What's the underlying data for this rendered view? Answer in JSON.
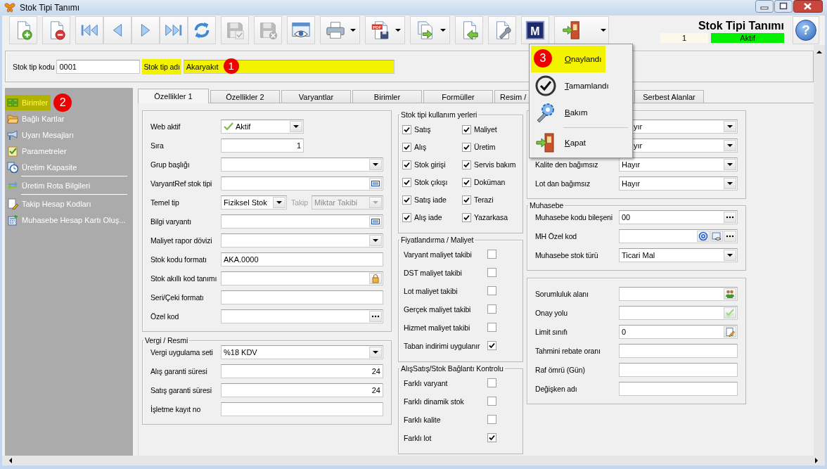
{
  "window": {
    "title": "Stok Tipi Tanımı"
  },
  "toolbar": [
    {
      "kind": "new",
      "disabled": false,
      "dropdown": false
    },
    {
      "kind": "delete",
      "disabled": false,
      "dropdown": false
    },
    {
      "kind": "first",
      "disabled": false,
      "dropdown": false
    },
    {
      "kind": "prev",
      "disabled": false,
      "dropdown": false
    },
    {
      "kind": "next",
      "disabled": false,
      "dropdown": false
    },
    {
      "kind": "last",
      "disabled": false,
      "dropdown": false
    },
    {
      "kind": "refresh",
      "disabled": false,
      "dropdown": false
    },
    {
      "kind": "save",
      "disabled": true,
      "dropdown": false
    },
    {
      "kind": "discard",
      "disabled": true,
      "dropdown": false
    },
    {
      "kind": "preview",
      "disabled": false,
      "dropdown": false
    },
    {
      "kind": "print",
      "disabled": false,
      "dropdown": true
    },
    {
      "kind": "pdf",
      "disabled": false,
      "dropdown": true,
      "label": "PDF"
    },
    {
      "kind": "copy",
      "disabled": false,
      "dropdown": true
    },
    {
      "kind": "import",
      "disabled": false,
      "dropdown": false
    },
    {
      "kind": "tools",
      "disabled": false,
      "dropdown": false
    },
    {
      "kind": "m",
      "disabled": false,
      "dropdown": false,
      "label": "M"
    },
    {
      "kind": "exit",
      "disabled": false,
      "dropdown": true
    }
  ],
  "header": {
    "title": "Stok Tipi Tanımı",
    "number": "1",
    "status": "Aktif",
    "help": "?"
  },
  "record": {
    "code_label": "Stok tip kodu",
    "code": "0001",
    "name_label": "Stok tip adı",
    "name": "Akaryakıt",
    "highlighted": true,
    "callout": "1"
  },
  "sidebar": {
    "items": [
      {
        "kind": "units",
        "label": "Birimler",
        "highlighted": true,
        "callout": "2"
      },
      {
        "kind": "folder",
        "label": "Bağlı Kartlar",
        "highlighted": false
      },
      {
        "kind": "alert",
        "label": "Uyarı Mesajları",
        "highlighted": false
      },
      {
        "kind": "params",
        "label": "Parametreler",
        "highlighted": false
      },
      {
        "kind": "capacity",
        "label": "Üretim Kapasite",
        "highlighted": false
      },
      {
        "kind": "separator"
      },
      {
        "kind": "route",
        "label": "Üretim Rota Bilgileri",
        "highlighted": false
      },
      {
        "kind": "separator"
      },
      {
        "kind": "tracking",
        "label": "Takip Hesap Kodları",
        "highlighted": false
      },
      {
        "kind": "accounting",
        "label": "Muhasebe Hesap Kartı Oluş...",
        "highlighted": false
      }
    ]
  },
  "tabs": [
    {
      "label": "Özellikler 1",
      "selected": true
    },
    {
      "label": "Özellikler 2",
      "selected": false
    },
    {
      "label": "Varyantlar",
      "selected": false
    },
    {
      "label": "Birimler",
      "selected": false
    },
    {
      "label": "Formüller",
      "selected": false
    },
    {
      "label": "Resim /",
      "selected": false
    },
    {
      "label": "Serbest Alanlar",
      "selected": false
    }
  ],
  "tab_page": {
    "columns": [
      {
        "sections": [
          {
            "kind": "fields",
            "rows": [
              {
                "kind": "status",
                "label": "Web aktif",
                "value": "Aktif",
                "buttons": [
                  {
                    "kind": "dropdown"
                  }
                ]
              },
              {
                "kind": "short",
                "label": "Sıra",
                "value": "1",
                "numeric": true
              },
              {
                "kind": "field",
                "label": "Grup başlığı",
                "buttons": [
                  {
                    "kind": "dropdown"
                  }
                ]
              },
              {
                "kind": "field",
                "label": "VaryantRef stok tipi",
                "buttons": [
                  {
                    "kind": "barcode"
                  }
                ]
              },
              {
                "kind": "pair",
                "label": "Temel tip",
                "value": "Fiziksel Stok",
                "buttons": [
                  {
                    "kind": "dropdown"
                  }
                ],
                "second_label": "Takip",
                "second_value": "Miktar Takibi",
                "second_disabled": true
              },
              {
                "kind": "field",
                "label": "Bilgi varyantı",
                "buttons": [
                  {
                    "kind": "barcode"
                  }
                ]
              },
              {
                "kind": "field",
                "label": "Maliyet rapor dövizi",
                "buttons": [
                  {
                    "kind": "dropdown"
                  }
                ]
              },
              {
                "kind": "field",
                "label": "Stok kodu formatı",
                "value": "AKA.0000"
              },
              {
                "kind": "field",
                "label": "Stok akıllı kod tanımı",
                "buttons": [
                  {
                    "kind": "lock"
                  }
                ]
              },
              {
                "kind": "field",
                "label": "Seri/Çeki formatı"
              },
              {
                "kind": "field",
                "label": "Özel kod",
                "buttons": [
                  {
                    "kind": "ellipsis"
                  }
                ]
              }
            ]
          },
          {
            "kind": "fields",
            "title": "Vergi / Resmi",
            "rows": [
              {
                "kind": "field",
                "label": "Vergi uygulama seti",
                "value": "%18 KDV",
                "buttons": [
                  {
                    "kind": "dropdown"
                  }
                ]
              },
              {
                "kind": "field",
                "label": "Alış garanti süresi",
                "value": "24",
                "numeric": true
              },
              {
                "kind": "field",
                "label": "Satış garanti süresi",
                "value": "24",
                "numeric": true
              },
              {
                "kind": "field",
                "label": "İşletme kayıt no"
              }
            ]
          }
        ]
      },
      {
        "sections": [
          {
            "kind": "check_grid",
            "title": "Stok tipi kullanım yerleri",
            "items": [
              {
                "label": "Satış",
                "checked": true
              },
              {
                "label": "Maliyet",
                "checked": true
              },
              {
                "label": "Alış",
                "checked": true
              },
              {
                "label": "Üretim",
                "checked": true
              },
              {
                "label": "Stok girişi",
                "checked": true
              },
              {
                "label": "Servis bakım",
                "checked": true
              },
              {
                "label": "Stok çıkışı",
                "checked": true
              },
              {
                "label": "Doküman",
                "checked": true
              },
              {
                "label": "Satış iade",
                "checked": true
              },
              {
                "label": "Terazi",
                "checked": true
              },
              {
                "label": "Alış iade",
                "checked": true
              },
              {
                "label": "Yazarkasa",
                "checked": true
              }
            ]
          },
          {
            "kind": "check_list",
            "title": "Fiyatlandırma / Maliyet",
            "items": [
              {
                "label": "Varyant maliyet takibi",
                "checked": false
              },
              {
                "label": "DST maliyet takibi",
                "checked": false
              },
              {
                "label": "Lot maliyet takibi",
                "checked": false
              },
              {
                "label": "Gerçek maliyet takibi",
                "checked": false
              },
              {
                "label": "Hizmet maliyet takibi",
                "checked": false
              },
              {
                "label": "Taban indirimi uygulanır",
                "checked": true
              }
            ]
          },
          {
            "kind": "check_list",
            "title": "AlışSatış/Stok Bağlantı Kontrolu",
            "items": [
              {
                "label": "Farklı varyant",
                "checked": false
              },
              {
                "label": "Farklı dinamik stok",
                "checked": false
              },
              {
                "label": "Farklı kalite",
                "checked": false
              },
              {
                "label": "Farklı lot",
                "checked": true
              }
            ]
          }
        ]
      },
      {
        "sections": [
          {
            "kind": "fields",
            "rows": [
              {
                "kind": "field",
                "value": "yır",
                "buttons": [
                  {
                    "kind": "dropdown"
                  }
                ]
              },
              {
                "kind": "field",
                "value": "yır",
                "buttons": [
                  {
                    "kind": "dropdown"
                  }
                ]
              },
              {
                "kind": "field",
                "label": "Kalite den bağımsız",
                "value": "Hayır",
                "buttons": [
                  {
                    "kind": "dropdown"
                  }
                ]
              },
              {
                "kind": "field",
                "label": "Lot dan bağımsız",
                "value": "Hayır",
                "buttons": [
                  {
                    "kind": "dropdown"
                  }
                ]
              }
            ]
          },
          {
            "kind": "fields",
            "title": "Muhasebe",
            "rows": [
              {
                "kind": "field",
                "label": "Muhasebe kodu bileşeni",
                "value": "00",
                "buttons": [
                  {
                    "kind": "ellipsis"
                  }
                ]
              },
              {
                "kind": "field",
                "label": "MH Özel kod",
                "buttons": [
                  {
                    "kind": "at"
                  },
                  {
                    "kind": "browse"
                  },
                  {
                    "kind": "ellipsis"
                  }
                ]
              },
              {
                "kind": "field",
                "label": "Muhasebe stok türü",
                "value": "Ticari Mal",
                "buttons": [
                  {
                    "kind": "dropdown"
                  }
                ]
              }
            ]
          },
          {
            "kind": "fields",
            "rows": [
              {
                "kind": "field",
                "label": "Sorumluluk alanı",
                "buttons": [
                  {
                    "kind": "people"
                  }
                ]
              },
              {
                "kind": "field",
                "label": "Onay yolu",
                "buttons": [
                  {
                    "kind": "approve"
                  }
                ]
              },
              {
                "kind": "field",
                "label": "Limit sınıfı",
                "value": "0",
                "buttons": [
                  {
                    "kind": "edit"
                  }
                ]
              },
              {
                "kind": "field",
                "label": "Tahmini rebate oranı"
              },
              {
                "kind": "field",
                "label": "Raf ömrü (Gün)"
              },
              {
                "kind": "field",
                "label": "Değişken adı"
              }
            ]
          }
        ]
      }
    ]
  },
  "menu": {
    "items": [
      {
        "kind": "approved",
        "label": "Onaylandı",
        "selected": true,
        "callout": "3"
      },
      {
        "kind": "completed",
        "label": "Tamamlandı",
        "selected": false
      },
      {
        "kind": "maintenance",
        "label": "Bakım",
        "selected": false
      },
      {
        "kind": "separator"
      },
      {
        "kind": "close",
        "label": "Kapat",
        "selected": false
      }
    ]
  }
}
